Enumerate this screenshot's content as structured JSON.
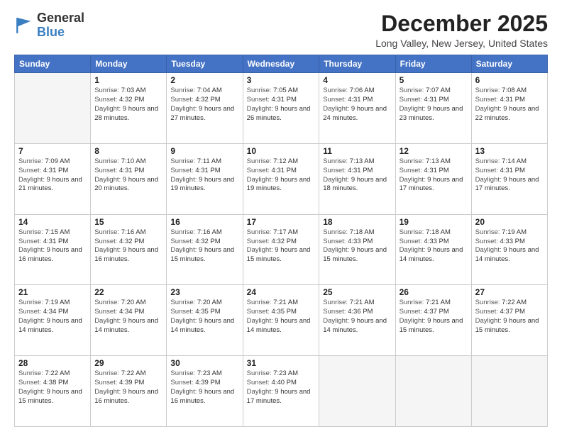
{
  "header": {
    "logo_general": "General",
    "logo_blue": "Blue",
    "title": "December 2025",
    "subtitle": "Long Valley, New Jersey, United States"
  },
  "days_of_week": [
    "Sunday",
    "Monday",
    "Tuesday",
    "Wednesday",
    "Thursday",
    "Friday",
    "Saturday"
  ],
  "weeks": [
    [
      {
        "day": "",
        "sunrise": "",
        "sunset": "",
        "daylight": ""
      },
      {
        "day": "1",
        "sunrise": "7:03 AM",
        "sunset": "4:32 PM",
        "daylight": "9 hours and 28 minutes."
      },
      {
        "day": "2",
        "sunrise": "7:04 AM",
        "sunset": "4:32 PM",
        "daylight": "9 hours and 27 minutes."
      },
      {
        "day": "3",
        "sunrise": "7:05 AM",
        "sunset": "4:31 PM",
        "daylight": "9 hours and 26 minutes."
      },
      {
        "day": "4",
        "sunrise": "7:06 AM",
        "sunset": "4:31 PM",
        "daylight": "9 hours and 24 minutes."
      },
      {
        "day": "5",
        "sunrise": "7:07 AM",
        "sunset": "4:31 PM",
        "daylight": "9 hours and 23 minutes."
      },
      {
        "day": "6",
        "sunrise": "7:08 AM",
        "sunset": "4:31 PM",
        "daylight": "9 hours and 22 minutes."
      }
    ],
    [
      {
        "day": "7",
        "sunrise": "7:09 AM",
        "sunset": "4:31 PM",
        "daylight": "9 hours and 21 minutes."
      },
      {
        "day": "8",
        "sunrise": "7:10 AM",
        "sunset": "4:31 PM",
        "daylight": "9 hours and 20 minutes."
      },
      {
        "day": "9",
        "sunrise": "7:11 AM",
        "sunset": "4:31 PM",
        "daylight": "9 hours and 19 minutes."
      },
      {
        "day": "10",
        "sunrise": "7:12 AM",
        "sunset": "4:31 PM",
        "daylight": "9 hours and 19 minutes."
      },
      {
        "day": "11",
        "sunrise": "7:13 AM",
        "sunset": "4:31 PM",
        "daylight": "9 hours and 18 minutes."
      },
      {
        "day": "12",
        "sunrise": "7:13 AM",
        "sunset": "4:31 PM",
        "daylight": "9 hours and 17 minutes."
      },
      {
        "day": "13",
        "sunrise": "7:14 AM",
        "sunset": "4:31 PM",
        "daylight": "9 hours and 17 minutes."
      }
    ],
    [
      {
        "day": "14",
        "sunrise": "7:15 AM",
        "sunset": "4:31 PM",
        "daylight": "9 hours and 16 minutes."
      },
      {
        "day": "15",
        "sunrise": "7:16 AM",
        "sunset": "4:32 PM",
        "daylight": "9 hours and 16 minutes."
      },
      {
        "day": "16",
        "sunrise": "7:16 AM",
        "sunset": "4:32 PM",
        "daylight": "9 hours and 15 minutes."
      },
      {
        "day": "17",
        "sunrise": "7:17 AM",
        "sunset": "4:32 PM",
        "daylight": "9 hours and 15 minutes."
      },
      {
        "day": "18",
        "sunrise": "7:18 AM",
        "sunset": "4:33 PM",
        "daylight": "9 hours and 15 minutes."
      },
      {
        "day": "19",
        "sunrise": "7:18 AM",
        "sunset": "4:33 PM",
        "daylight": "9 hours and 14 minutes."
      },
      {
        "day": "20",
        "sunrise": "7:19 AM",
        "sunset": "4:33 PM",
        "daylight": "9 hours and 14 minutes."
      }
    ],
    [
      {
        "day": "21",
        "sunrise": "7:19 AM",
        "sunset": "4:34 PM",
        "daylight": "9 hours and 14 minutes."
      },
      {
        "day": "22",
        "sunrise": "7:20 AM",
        "sunset": "4:34 PM",
        "daylight": "9 hours and 14 minutes."
      },
      {
        "day": "23",
        "sunrise": "7:20 AM",
        "sunset": "4:35 PM",
        "daylight": "9 hours and 14 minutes."
      },
      {
        "day": "24",
        "sunrise": "7:21 AM",
        "sunset": "4:35 PM",
        "daylight": "9 hours and 14 minutes."
      },
      {
        "day": "25",
        "sunrise": "7:21 AM",
        "sunset": "4:36 PM",
        "daylight": "9 hours and 14 minutes."
      },
      {
        "day": "26",
        "sunrise": "7:21 AM",
        "sunset": "4:37 PM",
        "daylight": "9 hours and 15 minutes."
      },
      {
        "day": "27",
        "sunrise": "7:22 AM",
        "sunset": "4:37 PM",
        "daylight": "9 hours and 15 minutes."
      }
    ],
    [
      {
        "day": "28",
        "sunrise": "7:22 AM",
        "sunset": "4:38 PM",
        "daylight": "9 hours and 15 minutes."
      },
      {
        "day": "29",
        "sunrise": "7:22 AM",
        "sunset": "4:39 PM",
        "daylight": "9 hours and 16 minutes."
      },
      {
        "day": "30",
        "sunrise": "7:23 AM",
        "sunset": "4:39 PM",
        "daylight": "9 hours and 16 minutes."
      },
      {
        "day": "31",
        "sunrise": "7:23 AM",
        "sunset": "4:40 PM",
        "daylight": "9 hours and 17 minutes."
      },
      {
        "day": "",
        "sunrise": "",
        "sunset": "",
        "daylight": ""
      },
      {
        "day": "",
        "sunrise": "",
        "sunset": "",
        "daylight": ""
      },
      {
        "day": "",
        "sunrise": "",
        "sunset": "",
        "daylight": ""
      }
    ]
  ],
  "labels": {
    "sunrise": "Sunrise:",
    "sunset": "Sunset:",
    "daylight": "Daylight:"
  }
}
